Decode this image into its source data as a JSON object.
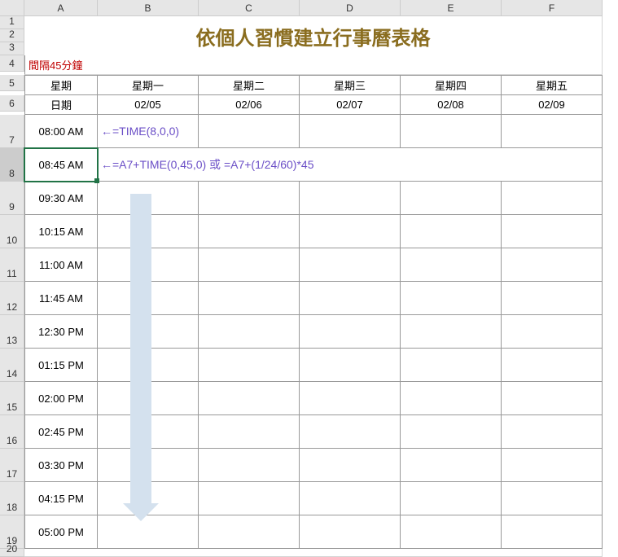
{
  "columns": [
    "A",
    "B",
    "C",
    "D",
    "E",
    "F"
  ],
  "rownums": [
    "1",
    "2",
    "3",
    "4",
    "5",
    "6",
    "7",
    "8",
    "9",
    "10",
    "11",
    "12",
    "13",
    "14",
    "15",
    "16",
    "17",
    "18",
    "19",
    "20"
  ],
  "title": "依個人習慣建立行事曆表格",
  "interval": "間隔45分鐘",
  "header_row": {
    "week": "星期",
    "days": [
      "星期一",
      "星期二",
      "星期三",
      "星期四",
      "星期五"
    ]
  },
  "date_row": {
    "label": "日期",
    "dates": [
      "02/05",
      "02/06",
      "02/07",
      "02/08",
      "02/09"
    ]
  },
  "times": [
    "08:00 AM",
    "08:45 AM",
    "09:30 AM",
    "10:15 AM",
    "11:00 AM",
    "11:45 AM",
    "12:30 PM",
    "01:15 PM",
    "02:00 PM",
    "02:45 PM",
    "03:30 PM",
    "04:15 PM",
    "05:00 PM"
  ],
  "formula1": "←=TIME(8,0,0)",
  "formula2": "←=A7+TIME(0,45,0) 或 =A7+(1/24/60)*45",
  "selected_row": "8"
}
